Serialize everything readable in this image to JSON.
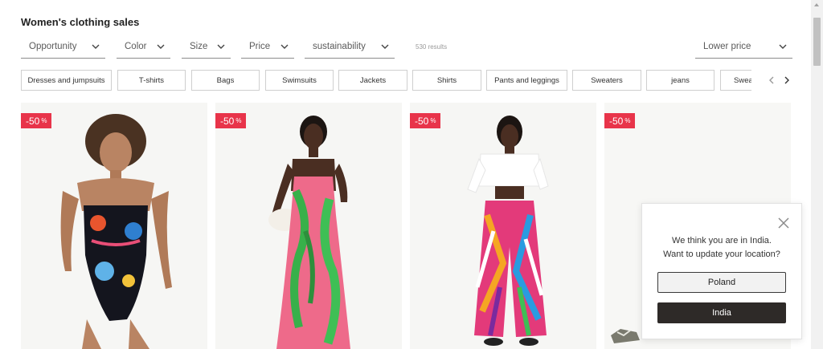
{
  "page": {
    "title": "Women's clothing sales"
  },
  "filters": [
    {
      "label": "Opportunity"
    },
    {
      "label": "Color"
    },
    {
      "label": "Size"
    },
    {
      "label": "Price"
    },
    {
      "label": "sustainability"
    }
  ],
  "results_text": "530 results",
  "sort": {
    "label": "Lower price"
  },
  "categories": [
    "Dresses and jumpsuits",
    "T-shirts",
    "Bags",
    "Swimsuits",
    "Jackets",
    "Shirts",
    "Pants and leggings",
    "Sweaters",
    "jeans",
    "Swea"
  ],
  "products": [
    {
      "discount": "-50",
      "pct": "%"
    },
    {
      "discount": "-50",
      "pct": "%"
    },
    {
      "discount": "-50",
      "pct": "%"
    },
    {
      "discount": "-50",
      "pct": "%"
    }
  ],
  "location_popup": {
    "line1": "We think you are in India.",
    "line2": "Want to update your location?",
    "option_poland": "Poland",
    "option_india": "India"
  },
  "icons": {
    "close": "close-icon",
    "chevron": "chevron-down-icon",
    "prev": "chevron-left-icon",
    "next": "chevron-right-icon"
  },
  "colors": {
    "discount_badge": "#e8344a",
    "primary_button": "#2e2a28"
  }
}
